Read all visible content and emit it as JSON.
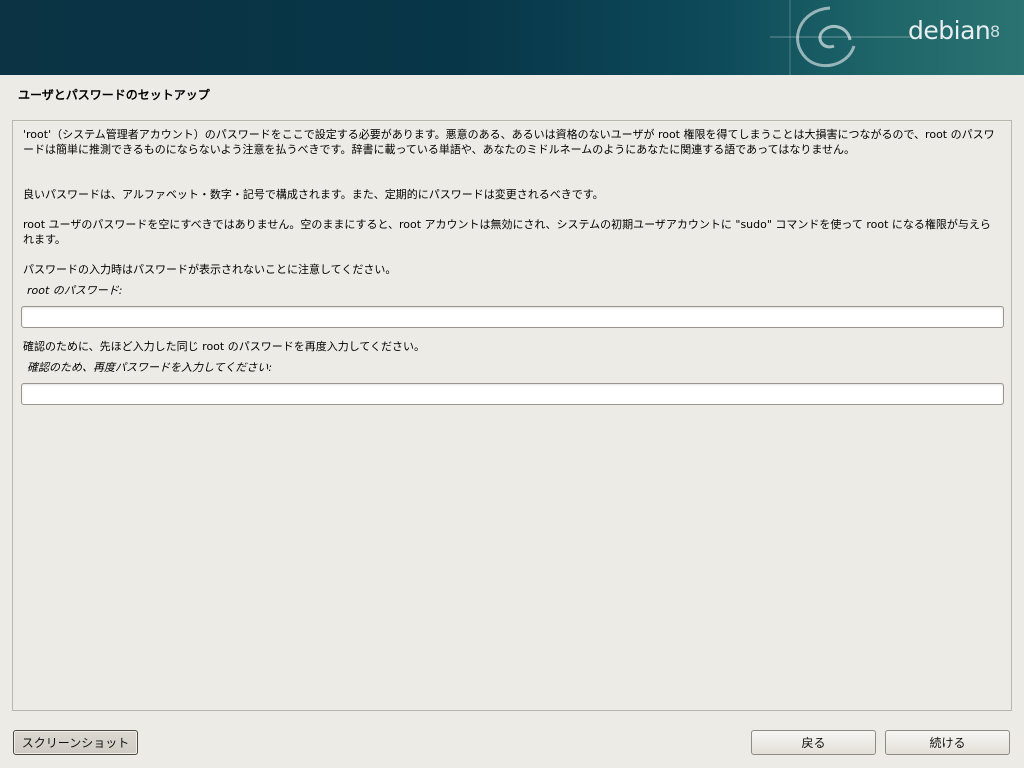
{
  "banner": {
    "brand": "debian",
    "version": "8"
  },
  "page_title": "ユーザとパスワードのセットアップ",
  "body": {
    "para1_a": "'root'（システム管理者アカウント）のパスワードをここで設定する必要があります。悪意のある、あるいは資格のないユーザが root 権限を得てしまうことは大損害につながるので、root のパスワードは簡単に推測できるものにならないよう注意を払うべきです。辞書に載っている単語や、あなたのミドルネームのようにあなたに関連する語であってはなりません。",
    "para2": "良いパスワードは、アルファベット・数字・記号で構成されます。また、定期的にパスワードは変更されるべきです。",
    "para3": "root ユーザのパスワードを空にすべきではありません。空のままにすると、root アカウントは無効にされ、システムの初期ユーザアカウントに \"sudo\" コマンドを使って root になる権限が与えられます。",
    "para4": "パスワードの入力時はパスワードが表示されないことに注意してください。",
    "root_password_label": "root のパスワード:",
    "confirm_text": "確認のために、先ほど入力した同じ root のパスワードを再度入力してください。",
    "confirm_label": "確認のため、再度パスワードを入力してください:"
  },
  "fields": {
    "root_password_value": "",
    "confirm_password_value": ""
  },
  "buttons": {
    "screenshot": "スクリーンショット",
    "back": "戻る",
    "continue": "続ける"
  },
  "colors": {
    "banner_dark": "#073648",
    "banner_light": "#2b7372",
    "background": "#edebe5"
  }
}
